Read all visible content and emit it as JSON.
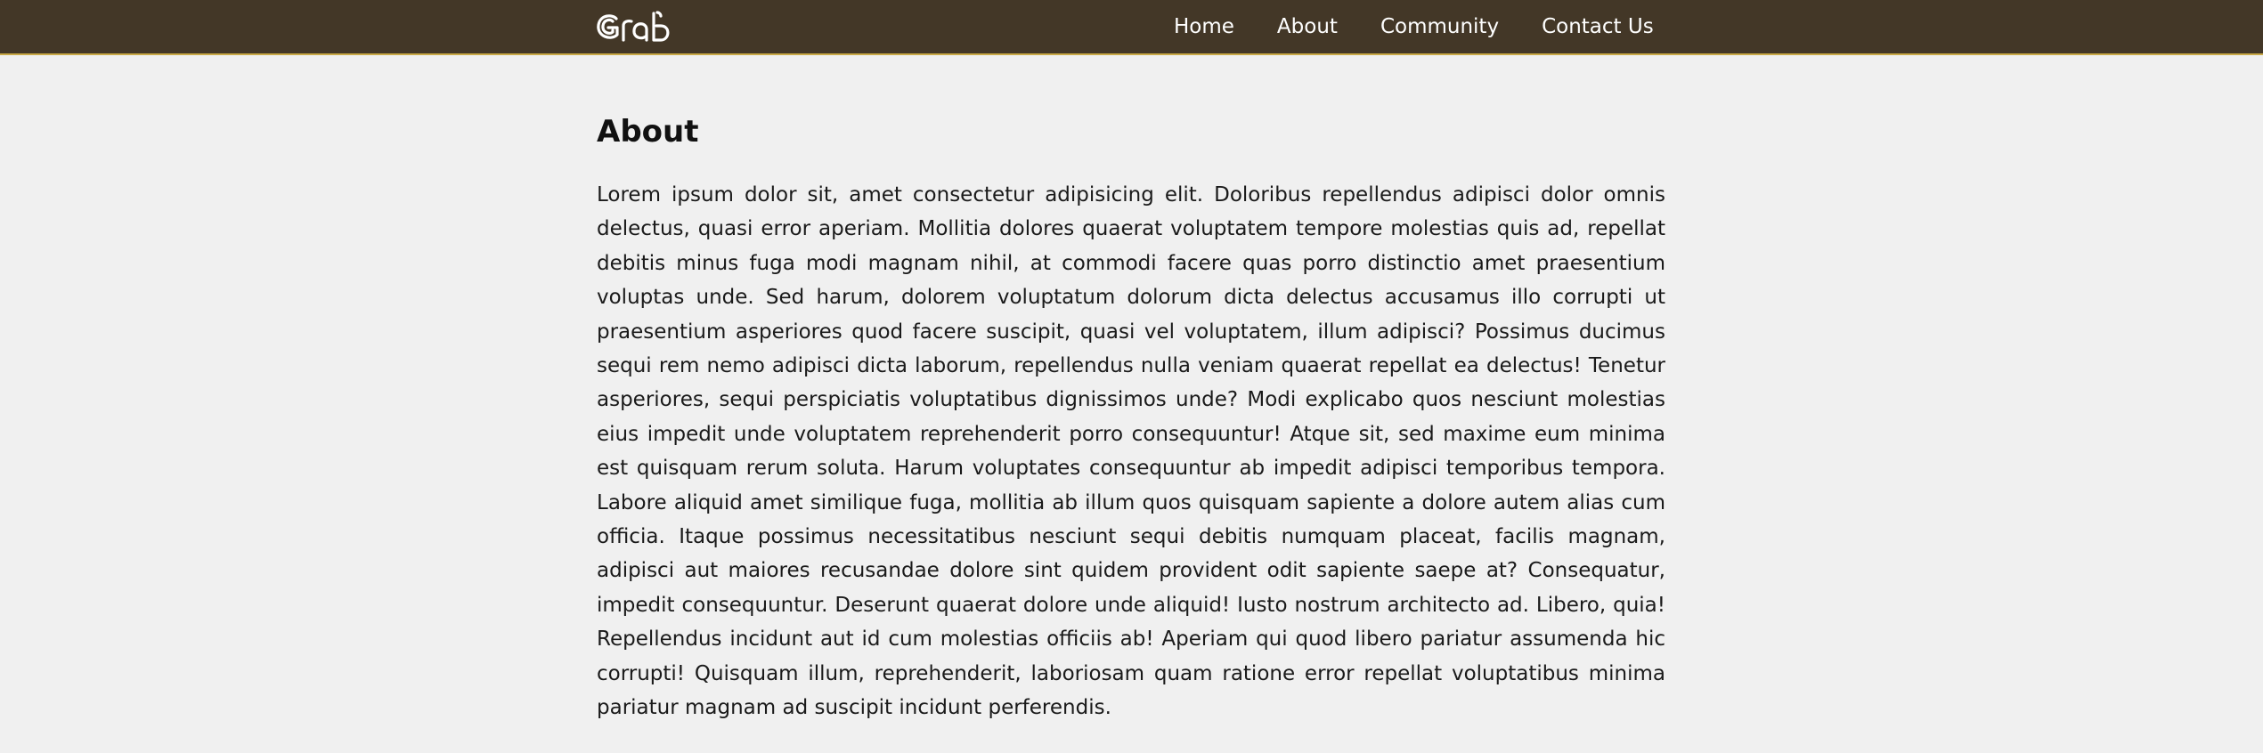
{
  "logo": {
    "text": "Grab",
    "icon": "grab-logo"
  },
  "nav": {
    "links": [
      {
        "label": "Home"
      },
      {
        "label": "About"
      },
      {
        "label": "Community"
      },
      {
        "label": "Contact Us"
      }
    ]
  },
  "page": {
    "title": "About",
    "body": "Lorem ipsum dolor sit, amet consectetur adipisicing elit. Doloribus repellendus adipisci dolor omnis delectus, quasi error aperiam. Mollitia dolores quaerat voluptatem tempore molestias quis ad, repellat debitis minus fuga modi magnam nihil, at commodi facere quas porro distinctio amet praesentium voluptas unde. Sed harum, dolorem voluptatum dolorum dicta delectus accusamus illo corrupti ut praesentium asperiores quod facere suscipit, quasi vel voluptatem, illum adipisci? Possimus ducimus sequi rem nemo adipisci dicta laborum, repellendus nulla veniam quaerat repellat ea delectus! Tenetur asperiores, sequi perspiciatis voluptatibus dignissimos unde? Modi explicabo quos nesciunt molestias eius impedit unde voluptatem reprehenderit porro consequuntur! Atque sit, sed maxime eum minima est quisquam rerum soluta. Harum voluptates consequuntur ab impedit adipisci temporibus tempora. Labore aliquid amet similique fuga, mollitia ab illum quos quisquam sapiente a dolore autem alias cum officia. Itaque possimus necessitatibus nesciunt sequi debitis numquam placeat, facilis magnam, adipisci aut maiores recusandae dolore sint quidem provident odit sapiente saepe at? Consequatur, impedit consequuntur. Deserunt quaerat dolore unde aliquid! Iusto nostrum architecto ad. Libero, quia! Repellendus incidunt aut id cum molestias officiis ab! Aperiam qui quod libero pariatur assumenda hic corrupti! Quisquam illum, reprehenderit, laboriosam quam ratione error repellat voluptatibus minima pariatur magnam ad suscipit incidunt perferendis."
  },
  "colors": {
    "navbar_bg": "#433727",
    "navbar_border": "#c9a946",
    "page_bg": "#f0f0f0",
    "text": "#1a1a1a"
  }
}
